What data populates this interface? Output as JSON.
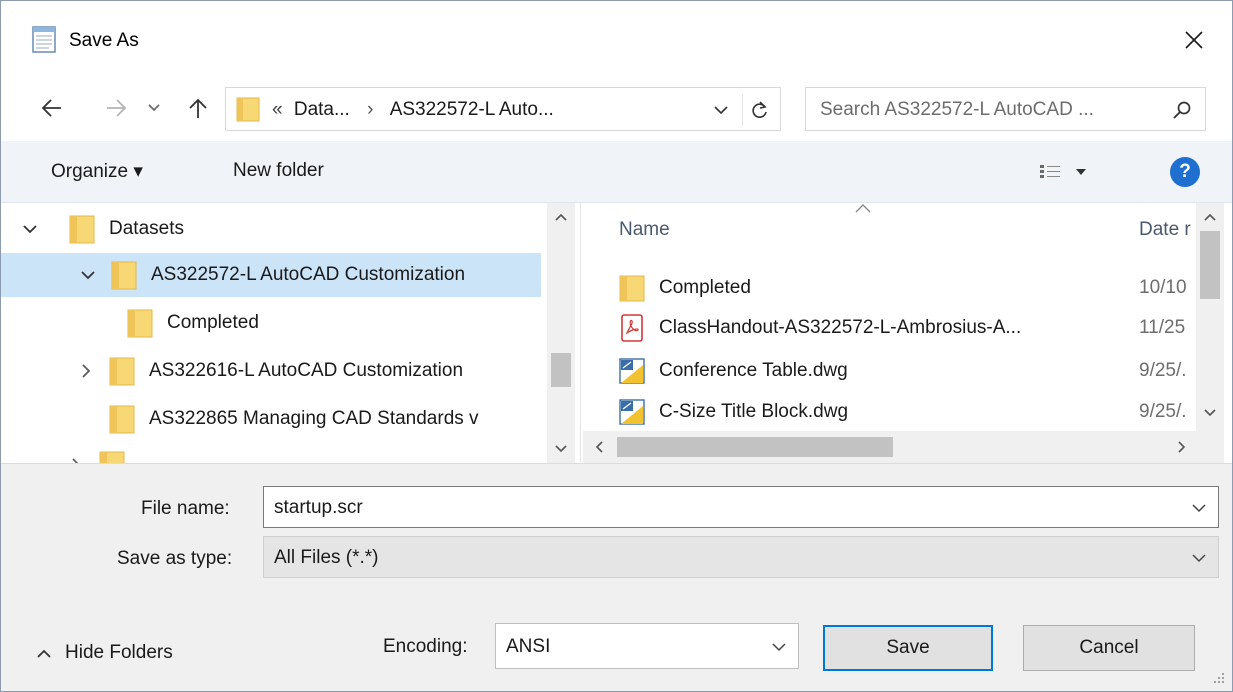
{
  "window": {
    "title": "Save As",
    "icon": "notepad-icon",
    "close_icon": "close-icon"
  },
  "nav": {
    "back_icon": "back-arrow-icon",
    "forward_icon": "forward-arrow-icon",
    "recent_icon": "chevron-down-icon",
    "up_icon": "up-arrow-icon",
    "breadcrumb_overflow": "«",
    "breadcrumb": [
      "Data...",
      "AS322572-L Auto..."
    ],
    "breadcrumb_sep": "›",
    "search_placeholder": "Search AS322572-L AutoCAD ..."
  },
  "toolbar": {
    "organize_label": "Organize ▾",
    "new_folder_label": "New folder",
    "help_label": "?"
  },
  "tree": {
    "items": [
      {
        "label": "Datasets",
        "expanded": true,
        "selected": false
      },
      {
        "label": "AS322572-L AutoCAD Customization",
        "expanded": true,
        "selected": true
      },
      {
        "label": "Completed",
        "expanded": false,
        "selected": false
      },
      {
        "label": "AS322616-L AutoCAD Customization",
        "expanded": false,
        "selected": false
      },
      {
        "label": "AS322865 Managing CAD Standards v",
        "expanded": false,
        "selected": false
      }
    ]
  },
  "files": {
    "columns": [
      "Name",
      "Date r"
    ],
    "rows": [
      {
        "name": "Completed",
        "date": "10/10",
        "type": "folder"
      },
      {
        "name": "ClassHandout-AS322572-L-Ambrosius-A...",
        "date": "11/25",
        "type": "pdf"
      },
      {
        "name": "Conference Table.dwg",
        "date": "9/25/.",
        "type": "dwg"
      },
      {
        "name": "C-Size Title Block.dwg",
        "date": "9/25/.",
        "type": "dwg"
      }
    ]
  },
  "form": {
    "file_name_label": "File name:",
    "file_name_value": "startup.scr",
    "save_type_label": "Save as type:",
    "save_type_value": "All Files  (*.*)",
    "hide_folders_label": "Hide Folders",
    "encoding_label": "Encoding:",
    "encoding_value": "ANSI",
    "save_button": "Save",
    "cancel_button": "Cancel"
  },
  "colors": {
    "accent": "#0078d7",
    "selection": "#cce4f7",
    "help": "#1e6fd0",
    "folder": "#f8d775"
  }
}
